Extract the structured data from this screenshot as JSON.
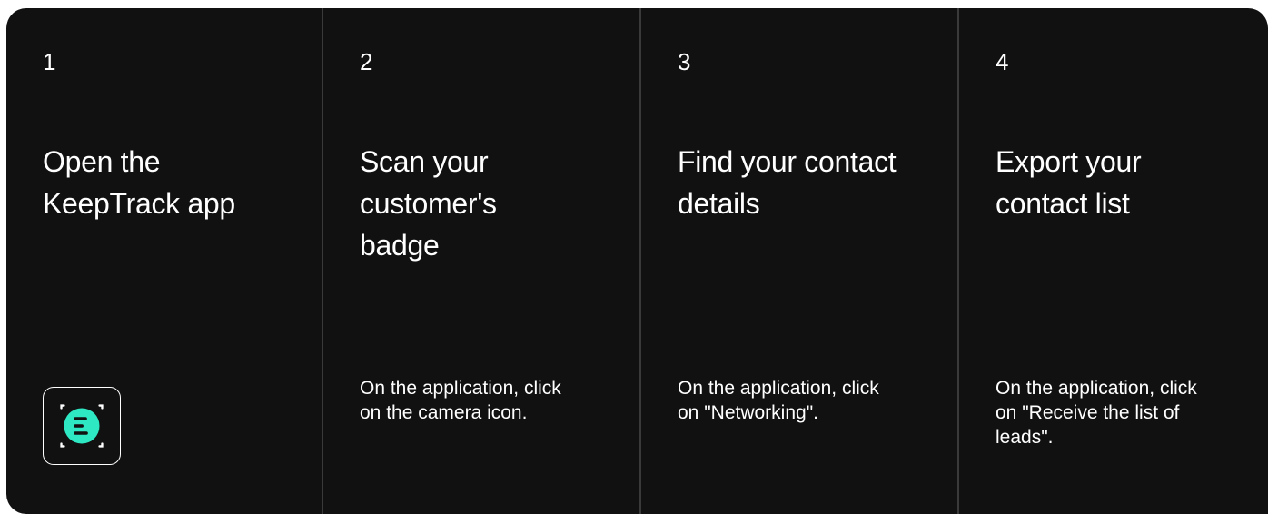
{
  "steps": [
    {
      "number": "1",
      "title": "Open the KeepTrack app",
      "icon": "keeptrack-app-icon"
    },
    {
      "number": "2",
      "title": "Scan your customer's badge",
      "description": "On the application, click on the camera icon."
    },
    {
      "number": "3",
      "title": "Find your contact details",
      "description": "On the application, click on \"Networking\"."
    },
    {
      "number": "4",
      "title": "Export your contact list",
      "description": "On the application, click on \"Receive the list of leads\"."
    }
  ],
  "colors": {
    "background": "#111111",
    "text": "#ffffff",
    "divider": "#3a3a3a",
    "icon_accent": "#2ee8c4"
  }
}
